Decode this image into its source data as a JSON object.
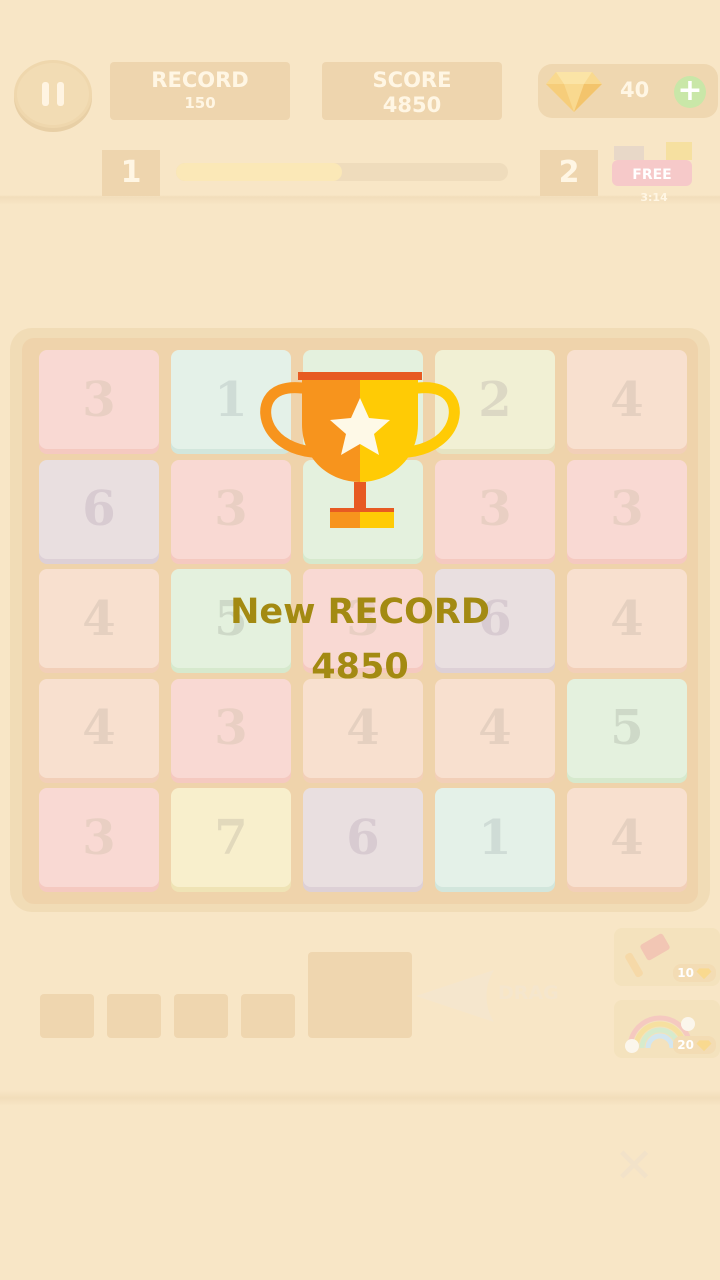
{
  "header": {
    "record_label": "RECORD",
    "record_value": "150",
    "score_label": "SCORE",
    "score_value": "4850",
    "gems": "40",
    "plus": "+"
  },
  "level": {
    "current": "1",
    "next": "2",
    "progress_fraction": 0.5
  },
  "free_offer": {
    "label": "FREE",
    "timer": "3:14"
  },
  "board": {
    "rows": [
      [
        {
          "v": "3",
          "c": "pink"
        },
        {
          "v": "1",
          "c": "sky"
        },
        {
          "v": "",
          "c": "mint"
        },
        {
          "v": "2",
          "c": "lime"
        },
        {
          "v": "4",
          "c": "peach"
        }
      ],
      [
        {
          "v": "6",
          "c": "lav"
        },
        {
          "v": "3",
          "c": "pink"
        },
        {
          "v": "",
          "c": "mint"
        },
        {
          "v": "3",
          "c": "pink"
        },
        {
          "v": "3",
          "c": "pink"
        }
      ],
      [
        {
          "v": "4",
          "c": "peach"
        },
        {
          "v": "5",
          "c": "mint"
        },
        {
          "v": "3",
          "c": "pink"
        },
        {
          "v": "6",
          "c": "lav"
        },
        {
          "v": "4",
          "c": "peach"
        }
      ],
      [
        {
          "v": "4",
          "c": "peach"
        },
        {
          "v": "3",
          "c": "pink"
        },
        {
          "v": "4",
          "c": "peach"
        },
        {
          "v": "4",
          "c": "peach"
        },
        {
          "v": "5",
          "c": "mint"
        }
      ],
      [
        {
          "v": "3",
          "c": "pink"
        },
        {
          "v": "7",
          "c": "yellow"
        },
        {
          "v": "6",
          "c": "lav"
        },
        {
          "v": "1",
          "c": "sky"
        },
        {
          "v": "4",
          "c": "peach"
        }
      ]
    ]
  },
  "overlay": {
    "title": "New RECORD",
    "value": "4850"
  },
  "bottom": {
    "drag_label": "DRAG",
    "hammer_cost": "10",
    "rainbow_cost": "20"
  },
  "colors": {
    "background": "#f8e6c6",
    "record_text": "#a38a12",
    "trophy_orange": "#f7941d",
    "trophy_yellow": "#ffcb05"
  }
}
